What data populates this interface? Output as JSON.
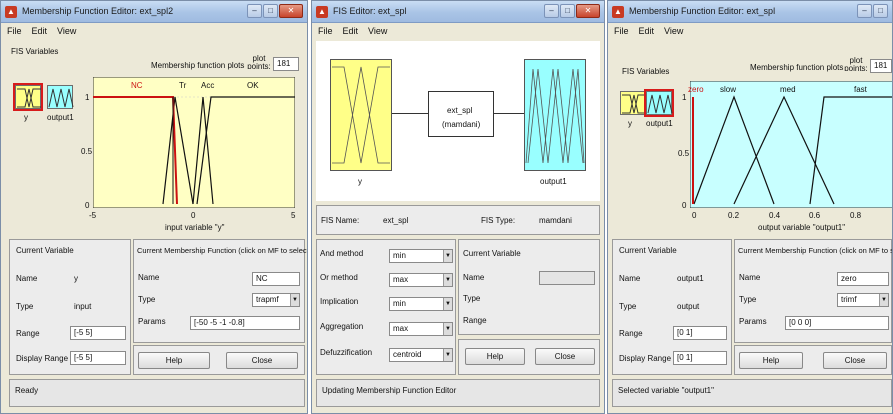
{
  "win1": {
    "title": "Membership Function Editor: ext_spl2",
    "menu": [
      "File",
      "Edit",
      "View"
    ],
    "fis_variables_label": "FIS Variables",
    "var_y": "y",
    "var_output1": "output1",
    "plot_title": "Membership function plots",
    "plot_points_label": "plot points:",
    "plot_points_value": "181",
    "mf_names": [
      "NC",
      "Tr",
      "Acc",
      "OK"
    ],
    "yticks": [
      "1",
      "0.5",
      "0"
    ],
    "xticks": [
      "-5",
      "0",
      "5"
    ],
    "xlabel": "input variable \"y\"",
    "current_variable": {
      "header": "Current Variable",
      "name_label": "Name",
      "name": "y",
      "type_label": "Type",
      "type": "input",
      "range_label": "Range",
      "range": "[-5 5]",
      "display_range_label": "Display Range",
      "display_range": "[-5 5]"
    },
    "current_mf": {
      "header": "Current Membership Function (click on MF to select)",
      "name_label": "Name",
      "name": "NC",
      "type_label": "Type",
      "type": "trapmf",
      "params_label": "Params",
      "params": "[-50 -5 -1 -0.8]"
    },
    "help": "Help",
    "close": "Close",
    "status": "Ready"
  },
  "win2": {
    "title": "FIS Editor: ext_spl",
    "menu": [
      "File",
      "Edit",
      "View"
    ],
    "input_label": "y",
    "center_name": "ext_spl",
    "center_type": "(mamdani)",
    "output_label": "output1",
    "fis_name_label": "FIS Name:",
    "fis_name": "ext_spl",
    "fis_type_label": "FIS Type:",
    "fis_type": "mamdani",
    "methods": [
      {
        "label": "And method",
        "value": "min"
      },
      {
        "label": "Or method",
        "value": "max"
      },
      {
        "label": "Implication",
        "value": "min"
      },
      {
        "label": "Aggregation",
        "value": "max"
      },
      {
        "label": "Defuzzification",
        "value": "centroid"
      }
    ],
    "current_variable": {
      "header": "Current Variable",
      "name_label": "Name",
      "type_label": "Type",
      "range_label": "Range"
    },
    "help": "Help",
    "close": "Close",
    "status": "Updating Membership Function Editor"
  },
  "win3": {
    "title": "Membership Function Editor: ext_spl",
    "menu": [
      "File",
      "Edit",
      "View"
    ],
    "fis_variables_label": "FIS Variables",
    "var_y": "y",
    "var_output1": "output1",
    "plot_title": "Membership function plots",
    "plot_points_label": "plot points:",
    "plot_points_value": "181",
    "mf_names": [
      "zero",
      "slow",
      "med",
      "fast"
    ],
    "yticks": [
      "1",
      "0.5",
      "0"
    ],
    "xticks": [
      "0",
      "0.2",
      "0.4",
      "0.6",
      "0.8"
    ],
    "xlabel": "output variable \"output1\"",
    "current_variable": {
      "header": "Current Variable",
      "name_label": "Name",
      "name": "output1",
      "type_label": "Type",
      "type": "output",
      "range_label": "Range",
      "range": "[0 1]",
      "display_range_label": "Display Range",
      "display_range": "[0 1]"
    },
    "current_mf": {
      "header": "Current Membership Function (click on MF to select)",
      "name_label": "Name",
      "name": "zero",
      "type_label": "Type",
      "type": "trimf",
      "params_label": "Params",
      "params": "[0 0 0]"
    },
    "help": "Help",
    "close": "Close",
    "status": "Selected variable \"output1\""
  },
  "colors": {
    "input_plot_bg": "#ffffc4",
    "output_plot_bg": "#c8ffff",
    "selected_mf": "#cc1111",
    "mf_line": "#111111"
  }
}
